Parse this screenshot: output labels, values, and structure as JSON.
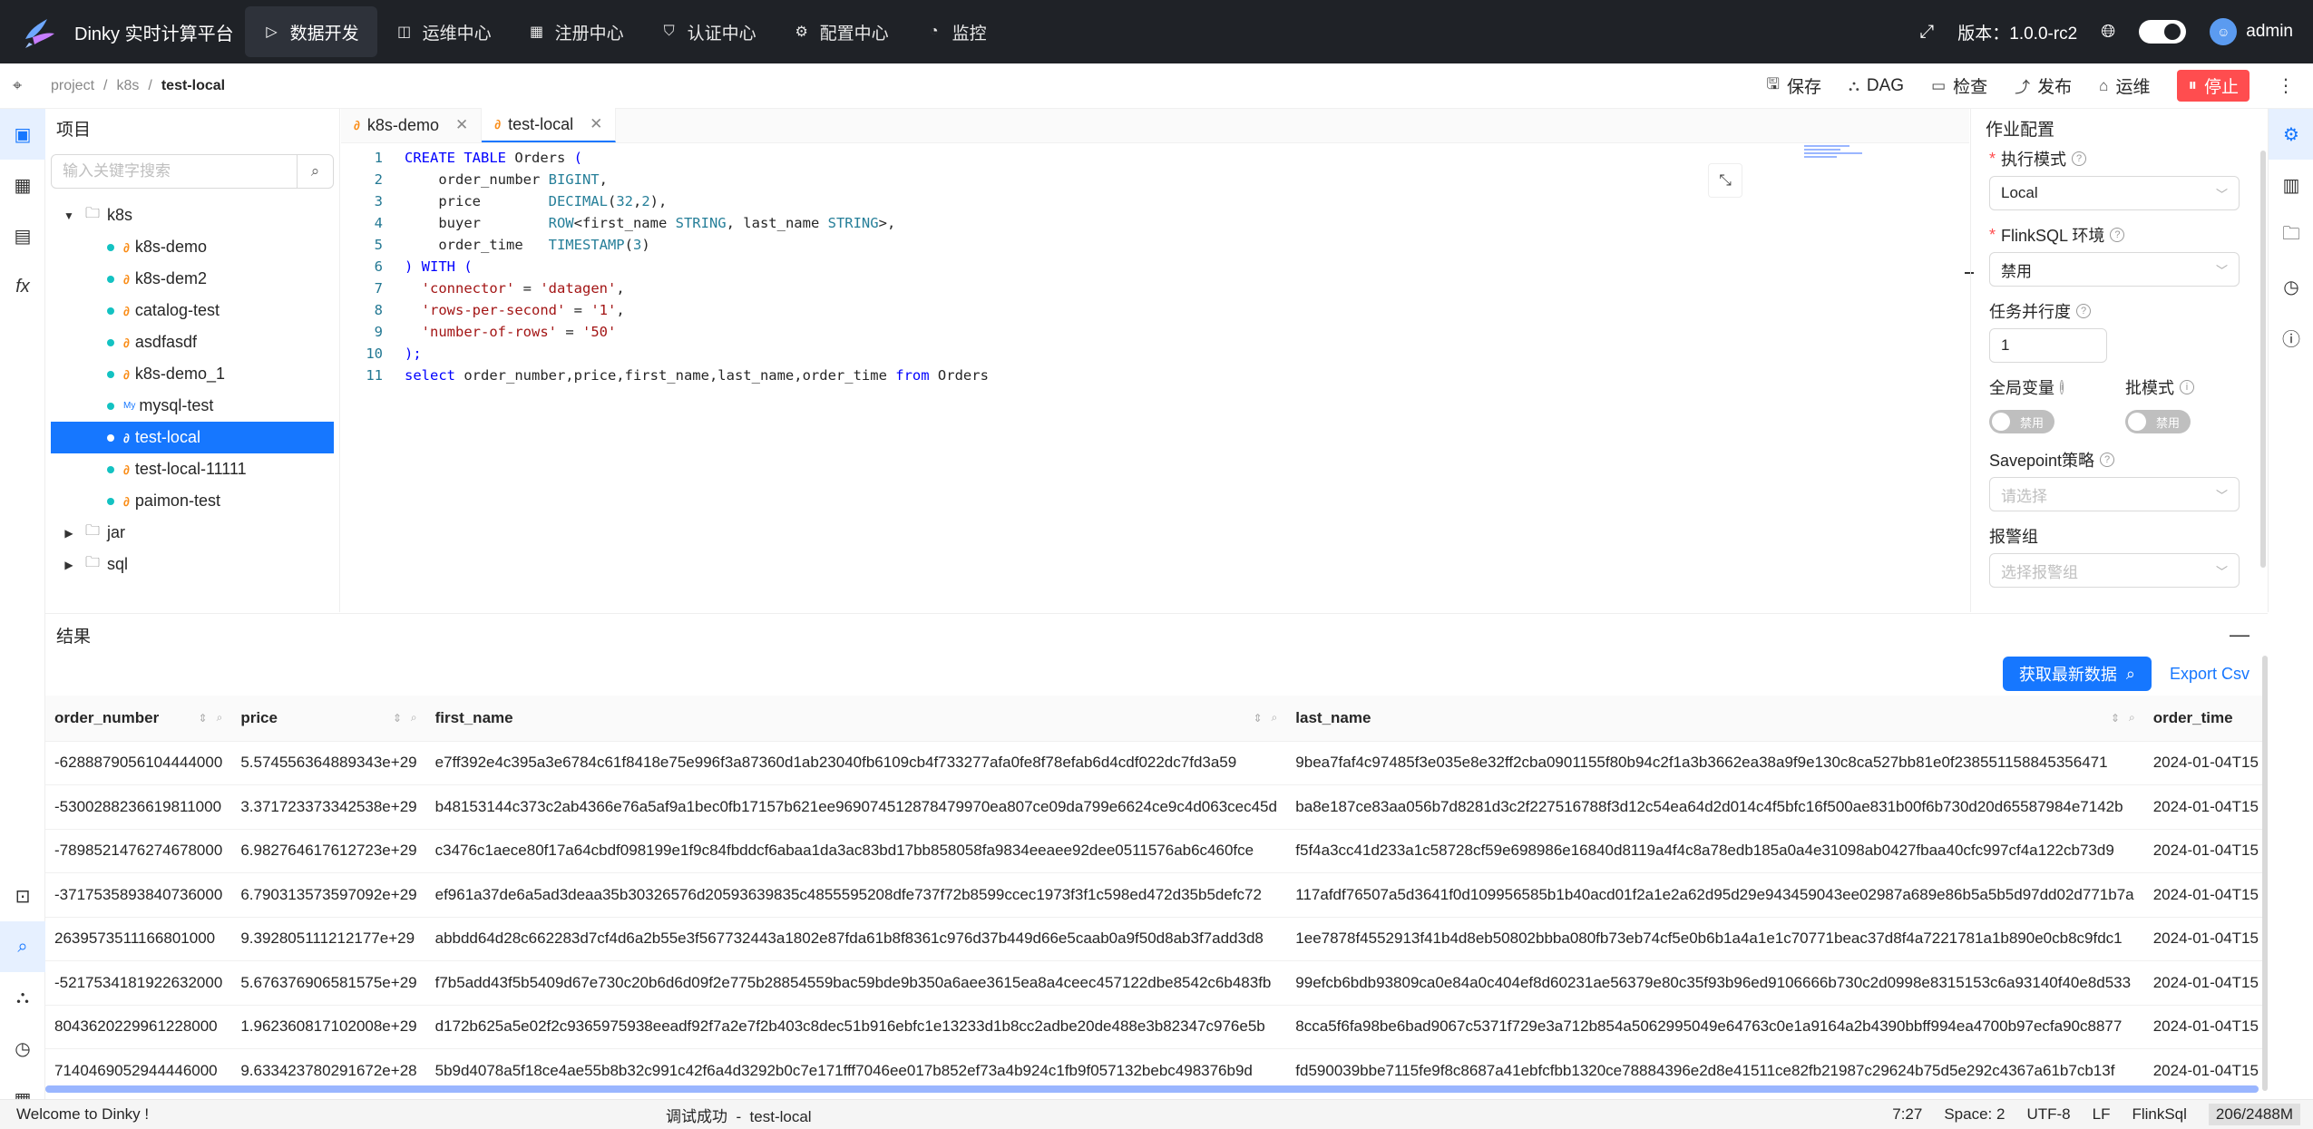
{
  "topbar": {
    "app_title": "Dinky 实时计算平台",
    "nav": [
      {
        "label": "数据开发",
        "icon": "code-icon"
      },
      {
        "label": "运维中心",
        "icon": "dashboard-icon"
      },
      {
        "label": "注册中心",
        "icon": "grid-icon"
      },
      {
        "label": "认证中心",
        "icon": "shield-icon"
      },
      {
        "label": "配置中心",
        "icon": "gear-icon"
      },
      {
        "label": "监控",
        "icon": "gauge-icon"
      }
    ],
    "version": "版本：1.0.0-rc2",
    "user": "admin",
    "active_color": "#2e323a"
  },
  "breadcrumb": [
    "project",
    "k8s",
    "test-local"
  ],
  "toolbar": {
    "save": "保存",
    "dag": "DAG",
    "check": "检查",
    "publish": "发布",
    "ops": "运维",
    "stop": "停止"
  },
  "project_panel": {
    "title": "项目",
    "search_placeholder": "输入关键字搜索",
    "tree": {
      "root": "k8s",
      "children": [
        "k8s-demo",
        "k8s-dem2",
        "catalog-test",
        "asdfasdf",
        "k8s-demo_1",
        "mysql-test",
        "test-local",
        "test-local-11111",
        "paimon-test"
      ],
      "selected": "test-local",
      "folders": [
        "jar",
        "sql"
      ]
    }
  },
  "editor": {
    "tabs": [
      {
        "label": "k8s-demo",
        "active": false
      },
      {
        "label": "test-local",
        "active": true
      }
    ],
    "lines": [
      {
        "n": "1",
        "t": [
          [
            "kw",
            "CREATE TABLE "
          ],
          [
            "pl",
            "Orders "
          ],
          [
            "kw",
            "("
          ]
        ]
      },
      {
        "n": "2",
        "t": [
          [
            "pl",
            "    order_number "
          ],
          [
            "ty",
            "BIGINT"
          ],
          [
            "pl",
            ","
          ]
        ]
      },
      {
        "n": "3",
        "t": [
          [
            "pl",
            "    price        "
          ],
          [
            "ty",
            "DECIMAL"
          ],
          [
            "pl",
            "("
          ],
          [
            "ty",
            "32"
          ],
          [
            "pl",
            ","
          ],
          [
            "ty",
            "2"
          ],
          [
            "pl",
            "),"
          ]
        ]
      },
      {
        "n": "4",
        "t": [
          [
            "pl",
            "    buyer        "
          ],
          [
            "ty",
            "ROW"
          ],
          [
            "pl",
            "<first_name "
          ],
          [
            "ty",
            "STRING"
          ],
          [
            "pl",
            ", last_name "
          ],
          [
            "ty",
            "STRING"
          ],
          [
            "pl",
            ">,"
          ]
        ]
      },
      {
        "n": "5",
        "t": [
          [
            "pl",
            "    order_time   "
          ],
          [
            "ty",
            "TIMESTAMP"
          ],
          [
            "pl",
            "("
          ],
          [
            "ty",
            "3"
          ],
          [
            "pl",
            ")"
          ]
        ]
      },
      {
        "n": "6",
        "t": [
          [
            "kw",
            ") WITH ("
          ]
        ]
      },
      {
        "n": "7",
        "t": [
          [
            "pl",
            "  "
          ],
          [
            "st",
            "'connector'"
          ],
          [
            "pl",
            " = "
          ],
          [
            "st",
            "'datagen'"
          ],
          [
            "pl",
            ","
          ]
        ]
      },
      {
        "n": "8",
        "t": [
          [
            "pl",
            "  "
          ],
          [
            "st",
            "'rows-per-second'"
          ],
          [
            "pl",
            " = "
          ],
          [
            "st",
            "'1'"
          ],
          [
            "pl",
            ","
          ]
        ]
      },
      {
        "n": "9",
        "t": [
          [
            "pl",
            "  "
          ],
          [
            "st",
            "'number-of-rows'"
          ],
          [
            "pl",
            " = "
          ],
          [
            "st",
            "'50'"
          ]
        ]
      },
      {
        "n": "10",
        "t": [
          [
            "kw",
            ");"
          ]
        ]
      },
      {
        "n": "11",
        "t": [
          [
            "kw",
            "select "
          ],
          [
            "pl",
            "order_number,price,first_name,last_name,order_time "
          ],
          [
            "kw",
            "from "
          ],
          [
            "pl",
            "Orders"
          ]
        ]
      }
    ]
  },
  "job_config": {
    "title": "作业配置",
    "exec_mode_label": "执行模式",
    "exec_mode_value": "Local",
    "flinksql_env_label": "FlinkSQL 环境",
    "flinksql_env_value": "禁用",
    "parallelism_label": "任务并行度",
    "parallelism_value": "1",
    "global_var_label": "全局变量",
    "global_var_state": "禁用",
    "batch_mode_label": "批模式",
    "batch_mode_state": "禁用",
    "savepoint_label": "Savepoint策略",
    "savepoint_placeholder": "请选择",
    "alert_label": "报警组",
    "alert_placeholder": "选择报警组"
  },
  "results": {
    "title": "结果",
    "fetch_button": "获取最新数据",
    "export_button": "Export Csv",
    "columns": [
      "order_number",
      "price",
      "first_name",
      "last_name",
      "order_time"
    ],
    "rows": [
      [
        "-6288879056104444000",
        "5.574556364889343e+29",
        "e7ff392e4c395a3e6784c61f8418e75e996f3a87360d1ab23040fb6109cb4f733277afa0fe8f78efab6d4cdf022dc7fd3a59",
        "9bea7faf4c97485f3e035e8e32ff2cba0901155f80b94c2f1a3b3662ea38a9f9e130c8ca527bb81e0f238551158845356471",
        "2024-01-04T15"
      ],
      [
        "-5300288236619811000",
        "3.371723373342538e+29",
        "b48153144c373c2ab4366e76a5af9a1bec0fb17157b621ee969074512878479970ea807ce09da799e6624ce9c4d063cec45d",
        "ba8e187ce83aa056b7d8281d3c2f227516788f3d12c54ea64d2d014c4f5bfc16f500ae831b00f6b730d20d65587984e7142b",
        "2024-01-04T15"
      ],
      [
        "-7898521476274678000",
        "6.982764617612723e+29",
        "c3476c1aece80f17a64cbdf098199e1f9c84fbddcf6abaa1da3ac83bd17bb858058fa9834eeaee92dee0511576ab6c460fce",
        "f5f4a3cc41d233a1c58728cf59e698986e16840d8119a4f4c8a78edb185a0a4e31098ab0427fbaa40cfc997cf4a122cb73d9",
        "2024-01-04T15"
      ],
      [
        "-3717535893840736000",
        "6.790313573597092e+29",
        "ef961a37de6a5ad3deaa35b30326576d20593639835c4855595208dfe737f72b8599ccec1973f3f1c598ed472d35b5defc72",
        "117afdf76507a5d3641f0d109956585b1b40acd01f2a1e2a62d95d29e943459043ee02987a689e86b5a5b5d97dd02d771b7a",
        "2024-01-04T15"
      ],
      [
        "2639573511166801000",
        "9.392805111212177e+29",
        "abbdd64d28c662283d7cf4d6a2b55e3f567732443a1802e87fda61b8f8361c976d37b449d66e5caab0a9f50d8ab3f7add3d8",
        "1ee7878f4552913f41b4d8eb50802bbba080fb73eb74cf5e0b6b1a4a1e1c70771beac37d8f4a7221781a1b890e0cb8c9fdc1",
        "2024-01-04T15"
      ],
      [
        "-5217534181922632000",
        "5.676376906581575e+29",
        "f7b5add43f5b5409d67e730c20b6d6d09f2e775b28854559bac59bde9b350a6aee3615ea8a4ceec457122dbe8542c6b483fb",
        "99efcb6bdb93809ca0e84a0c404ef8d60231ae56379e80c35f93b96ed9106666b730c2d0998e8315153c6a93140f40e8d533",
        "2024-01-04T15"
      ],
      [
        "8043620229961228000",
        "1.962360817102008e+29",
        "d172b625a5e02f2c9365975938eeadf92f7a2e7f2b403c8dec51b916ebfc1e13233d1b8cc2adbe20de488e3b82347c976e5b",
        "8cca5f6fa98be6bad9067c5371f729e3a712b854a5062995049e64763c0e1a9164a2b4390bbff994ea4700b97ecfa90c8877",
        "2024-01-04T15"
      ],
      [
        "7140469052944446000",
        "9.633423780291672e+28",
        "5b9d4078a5f18ce4ae55b8b32c991c42f6a4d3292b0c7e171fff7046ee017b852ef73a4b924c1fb9f057132bebc498376b9d",
        "fd590039bbe7115fe9f8c8687a41ebfcfbb1320ce78884396e2d8e41511ce82fb21987c29624b75d5e292c4367a61b7cb13f",
        "2024-01-04T15"
      ]
    ]
  },
  "statusbar": {
    "welcome": "Welcome to Dinky !",
    "message": "调试成功  -  test-local",
    "cursor": "7:27",
    "indent": "Space: 2",
    "encoding": "UTF-8",
    "eol": "LF",
    "language": "FlinkSql",
    "memory": "206/2488M"
  }
}
